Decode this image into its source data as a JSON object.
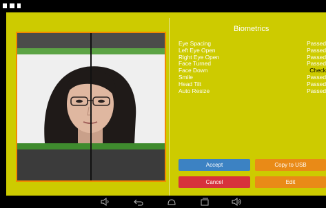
{
  "biometrics": {
    "title": "Biometrics",
    "items": [
      {
        "label": "Eye Spacing",
        "status": "Passed"
      },
      {
        "label": "Left Eye Open",
        "status": "Passed"
      },
      {
        "label": "Right Eye Open",
        "status": "Passed"
      },
      {
        "label": "Face Turned",
        "status": "Passed"
      },
      {
        "label": "Face Down",
        "status": "Check"
      },
      {
        "label": "Smile",
        "status": "Passed"
      },
      {
        "label": "Head Tilt",
        "status": "Passed"
      },
      {
        "label": "Auto Resize",
        "status": "Passed"
      }
    ]
  },
  "buttons": {
    "accept": "Accept",
    "copy_usb": "Copy to USB",
    "cancel": "Cancel",
    "edit": "Edit"
  },
  "colors": {
    "background": "#cdcb00",
    "accept": "#3c82c3",
    "cancel": "#d7323c",
    "orange": "#e98a17",
    "photo_border": "#f18a00",
    "guide_green": "#5ca345"
  },
  "status_icons": [
    "person-icon",
    "image-icon",
    "sd-card-icon"
  ],
  "nav_icons": [
    "volume-down-icon",
    "back-icon",
    "home-icon",
    "recent-apps-icon",
    "volume-up-icon"
  ]
}
